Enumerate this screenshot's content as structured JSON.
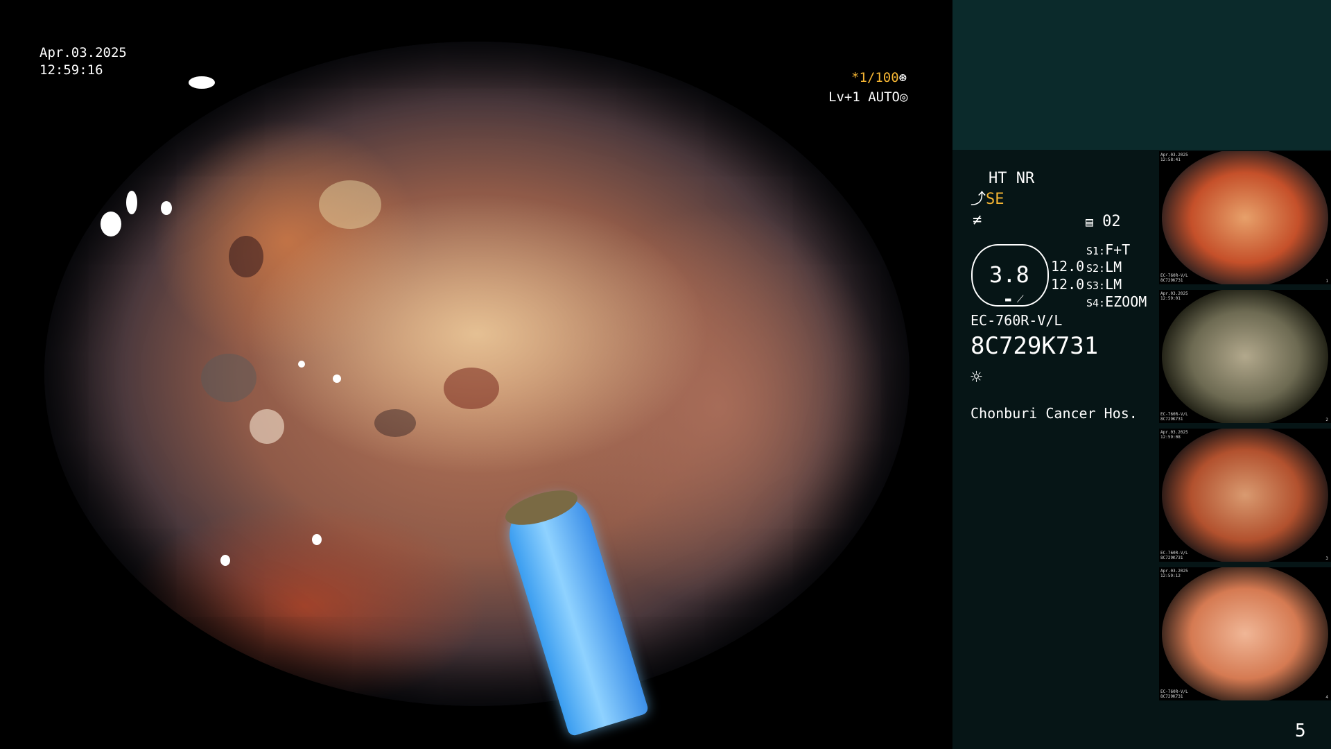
{
  "overlay": {
    "date": "Apr.03.2025",
    "time": "12:59:16",
    "shutter": "*1/100",
    "level": "Lv+1 AUTO"
  },
  "panel": {
    "ht_nr": "HT NR",
    "se": "SE",
    "frame_no": "02",
    "scale_value": "3.8",
    "scale_a": "12.0",
    "scale_b": "12.0",
    "s_settings": [
      {
        "key": "S1:",
        "value": "F+T"
      },
      {
        "key": "S2:",
        "value": "LM"
      },
      {
        "key": "S3:",
        "value": "LM"
      },
      {
        "key": "S4:",
        "value": "EZOOM"
      }
    ],
    "scope_model": "EC-760R-V/L",
    "serial": "8C729K731",
    "hospital": "Chonburi Cancer Hos.",
    "page_number": "5"
  },
  "thumbnails": [
    {
      "tl": "Apr.03.2025\n12:58:41",
      "bl": "EC-760R-V/L\n8C729K731",
      "br": "1",
      "tone": [
        "#e7a06a",
        "#c5502a",
        "#3a2420"
      ]
    },
    {
      "tl": "Apr.03.2025\n12:59:01",
      "bl": "EC-760R-V/L\n8C729K731",
      "br": "2",
      "tone": [
        "#b2a88c",
        "#6d6a52",
        "#242418"
      ]
    },
    {
      "tl": "Apr.03.2025\n12:59:08",
      "bl": "EC-760R-V/L\n8C729K731",
      "br": "3",
      "tone": [
        "#d99a70",
        "#b2512e",
        "#2e1c18"
      ]
    },
    {
      "tl": "Apr.03.2025\n12:59:12",
      "bl": "EC-760R-V/L\n8C729K731",
      "br": "4",
      "tone": [
        "#f0b696",
        "#d57a52",
        "#40281e"
      ]
    }
  ],
  "colors": {
    "panel_top": "#0b2a2b",
    "panel_bg": "#061516",
    "accent_yellow": "#f5b533"
  }
}
